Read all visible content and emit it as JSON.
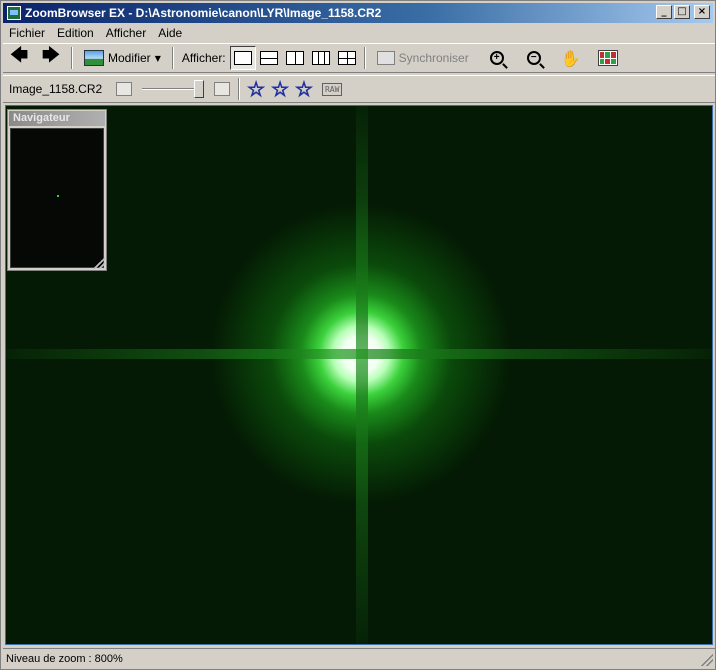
{
  "window": {
    "title": "ZoomBrowser EX - D:\\Astronomie\\canon\\LYR\\Image_1158.CR2",
    "minimize": "_",
    "maximize": "□",
    "close": "×"
  },
  "menu": {
    "items": [
      "Fichier",
      "Edition",
      "Afficher",
      "Aide"
    ]
  },
  "toolbar": {
    "back_icon": "arrow-left-icon",
    "forward_icon": "arrow-right-icon",
    "modify_label": "Modifier",
    "display_label": "Afficher:",
    "layouts": [
      "single",
      "split-horizontal",
      "split-vertical",
      "triple-vertical",
      "quad"
    ],
    "active_layout": "single",
    "sync_label": "Synchroniser",
    "zoom_in_sign": "+",
    "zoom_out_sign": "−",
    "hand_glyph": "✋"
  },
  "subtoolbar": {
    "filename": "Image_1158.CR2",
    "zoom_slider_level": 1.0,
    "stars": [
      "☆",
      "☆",
      "☆"
    ],
    "raw_label": "RAW"
  },
  "navigator": {
    "title": "Navigateur"
  },
  "status": {
    "text": "Niveau de zoom : 800%"
  },
  "colors": {
    "titlebar_start": "#0a246a",
    "titlebar_end": "#a6caf0",
    "star_core": "#ffffff",
    "star_glow": "#3cd23c",
    "background_space": "#041a04"
  }
}
